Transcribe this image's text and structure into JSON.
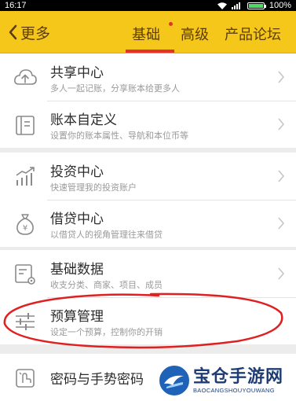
{
  "status_bar": {
    "time": "16:17",
    "battery": "100%"
  },
  "header": {
    "back_label": "更多",
    "tabs": [
      {
        "label": "基础",
        "active": true,
        "has_dot": true
      },
      {
        "label": "高级",
        "active": false
      },
      {
        "label": "产品论坛",
        "active": false
      }
    ]
  },
  "groups": [
    {
      "items": [
        {
          "title": "共享中心",
          "subtitle": "多人一起记账，分享账本给更多人",
          "icon": "cloud-upload-icon"
        },
        {
          "title": "账本自定义",
          "subtitle": "设置你的账本属性、导航和本位币等",
          "icon": "book-settings-icon"
        }
      ]
    },
    {
      "items": [
        {
          "title": "投资中心",
          "subtitle": "快速管理我的投资账户",
          "icon": "investment-chart-icon"
        },
        {
          "title": "借贷中心",
          "subtitle": "以借贷人的视角管理往来借贷",
          "icon": "money-bag-icon"
        }
      ]
    },
    {
      "items": [
        {
          "title": "基础数据",
          "subtitle": "收支分类、商家、项目、成员",
          "icon": "data-settings-icon"
        },
        {
          "title": "预算管理",
          "subtitle": "设定一个预算，控制你的开销",
          "icon": "budget-sliders-icon"
        }
      ]
    },
    {
      "items": [
        {
          "title": "密码与手势密码",
          "subtitle": "",
          "icon": "password-lock-icon"
        }
      ]
    }
  ],
  "watermark": {
    "title": "宝仓手游网",
    "subtitle": "BAOCANGSHOUYOUWANG"
  },
  "colors": {
    "header": "#f6c71b",
    "accent_red": "#e2332b",
    "header_text": "#5a3d0a"
  }
}
